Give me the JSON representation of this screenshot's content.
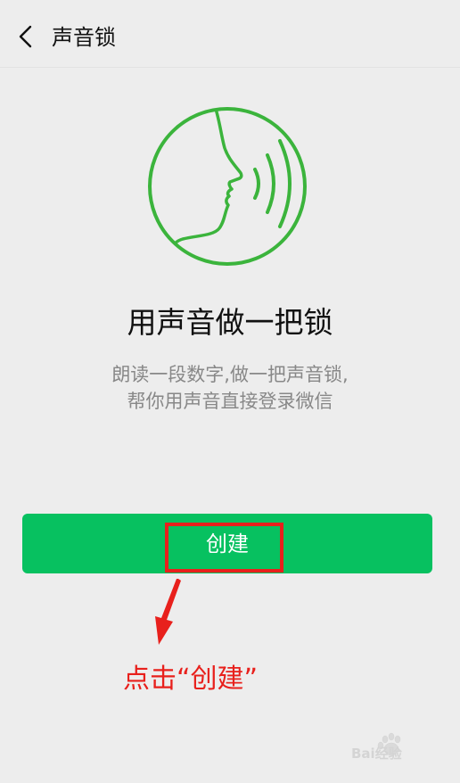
{
  "nav": {
    "title": "声音锁",
    "back_icon": "chevron-left-icon"
  },
  "hero": {
    "icon": "voice-speaking-face-icon",
    "icon_color": "#3bb43c",
    "headline": "用声音做一把锁",
    "description_lines": [
      "朗读一段数字,做一把声音锁,",
      "帮你用声音直接登录微信"
    ]
  },
  "actions": {
    "create_label": "创建",
    "create_color": "#07c160"
  },
  "annotation": {
    "text": "点击“创建”",
    "color": "#e8201c"
  },
  "watermark": {
    "text": "Bai经验",
    "icon": "baidu-paw-logo"
  }
}
